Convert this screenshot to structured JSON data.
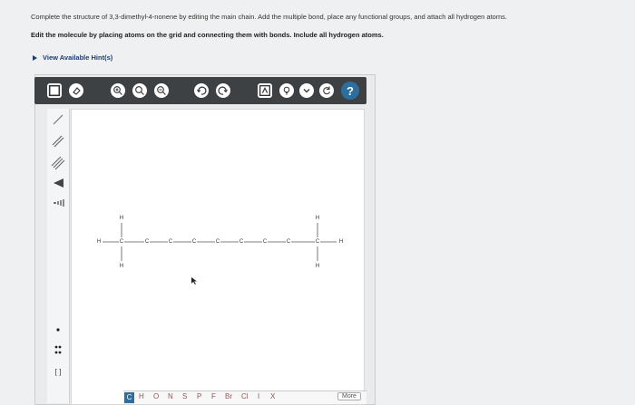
{
  "instructions": {
    "main": "Complete the structure of 3,3-dimethyl-4-nonene by editing the main chain. Add the multiple bond, place any functional groups, and attach all hydrogen atoms.",
    "sub": "Edit the molecule by placing atoms on the grid and connecting them with bonds. Include all hydrogen atoms."
  },
  "hint": {
    "label": "View Available Hint(s)"
  },
  "toolbar": {
    "icons": [
      "new-icon",
      "eraser-icon",
      "zoom-in-icon",
      "zoom-reset-icon",
      "zoom-out-icon",
      "undo-icon",
      "redo-icon",
      "template-icon",
      "lightbulb-icon",
      "dropdown-icon",
      "rotate-icon",
      "help-icon"
    ],
    "help_label": "?"
  },
  "left_tools": {
    "icons": [
      "single-bond-icon",
      "double-bond-icon",
      "triple-bond-icon",
      "wedge-bond-icon",
      "hash-bond-icon",
      "charge-icon",
      "lone-pair-icon",
      "bracket-icon"
    ],
    "bracket_label": "[ ]"
  },
  "molecule": {
    "chain_atoms": [
      "C",
      "C",
      "C",
      "C",
      "C",
      "C",
      "C",
      "C",
      "C"
    ],
    "end_h": "H",
    "h_label": "H"
  },
  "elements": [
    "C",
    "H",
    "O",
    "N",
    "S",
    "P",
    "F",
    "Br",
    "Cl",
    "I",
    "X"
  ],
  "active_element": "C",
  "more_label": "More",
  "colors": {
    "toolbar_bg": "#3e4144",
    "accent": "#2d6e9e",
    "link": "#1f3d6b"
  }
}
